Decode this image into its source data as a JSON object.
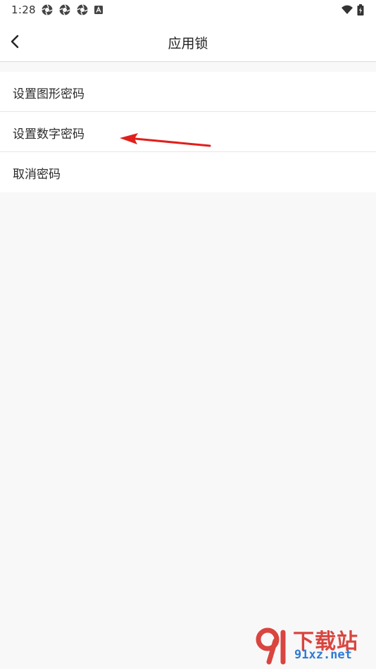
{
  "status_bar": {
    "time": "1:28",
    "icons": [
      "aperture-icon",
      "aperture-icon",
      "aperture-icon",
      "a-badge-icon",
      "wifi-icon",
      "battery-charging-icon"
    ]
  },
  "app_bar": {
    "title": "应用锁",
    "back_icon": "chevron-left-icon"
  },
  "menu": {
    "items": [
      {
        "label": "设置图形密码"
      },
      {
        "label": "设置数字密码"
      },
      {
        "label": "取消密码"
      }
    ]
  },
  "annotation": {
    "color": "#e0201c"
  },
  "watermark": {
    "logo_text": "下载站",
    "site": "91xz.net"
  },
  "colors": {
    "background": "#f8f8f8",
    "surface": "#ffffff",
    "divider": "#e6e6e6"
  }
}
